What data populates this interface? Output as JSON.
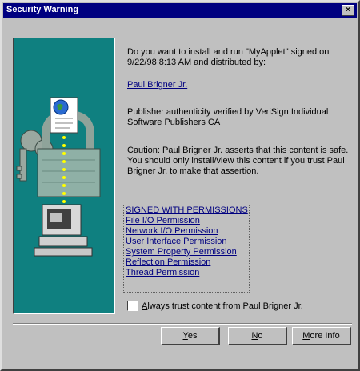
{
  "window": {
    "title": "Security Warning",
    "close_glyph": "×"
  },
  "message": {
    "line1": "Do you want to install and run \"MyApplet\" signed on",
    "line2": "9/22/98 8:13 AM and distributed by:",
    "publisher_link": "Paul Brigner Jr.",
    "verify1": "Publisher authenticity verified by VeriSign Individual",
    "verify2": "Software Publishers CA",
    "caution1": "Caution: Paul Brigner Jr. asserts that this content is safe.",
    "caution2": "You should only install/view this content if you trust Paul",
    "caution3": "Brigner Jr. to make that assertion."
  },
  "permissions": {
    "header": "SIGNED WITH PERMISSIONS",
    "items": [
      "File I/O Permission",
      "Network I/O Permission",
      "User Interface Permission",
      "System Property Permission",
      "Reflection Permission",
      "Thread Permission"
    ]
  },
  "checkbox": {
    "label_first": "A",
    "label_rest": "lways trust content from Paul Brigner Jr.",
    "checked": false
  },
  "buttons": {
    "yes_first": "Y",
    "yes_rest": "es",
    "no_first": "N",
    "no_rest": "o",
    "more_first": "M",
    "more_rest": "ore Info"
  },
  "colors": {
    "titlebar": "#000080",
    "art_bg": "#0f8080",
    "link": "#000080"
  },
  "icons": [
    "close-icon",
    "certificate-icon",
    "keys-icon",
    "padlock-icon",
    "computer-icon"
  ]
}
